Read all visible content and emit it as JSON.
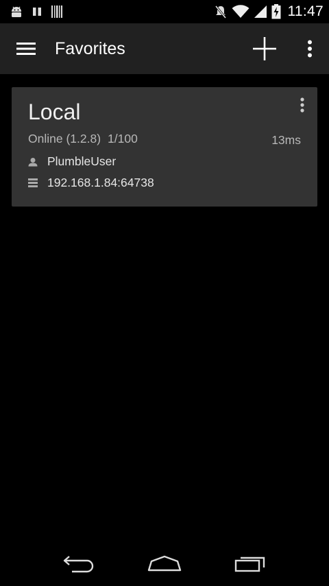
{
  "status_bar": {
    "time": "11:47",
    "left_icons": [
      "android-debug-icon",
      "pause-icon",
      "barcode-icon"
    ],
    "right_icons": [
      "mute-icon",
      "wifi-icon",
      "signal-icon",
      "battery-charging-icon"
    ]
  },
  "action_bar": {
    "title": "Favorites",
    "menu_icon": "hamburger-menu-icon",
    "add_icon": "plus-icon",
    "overflow_icon": "overflow-menu-icon"
  },
  "servers": [
    {
      "name": "Local",
      "status": "Online (1.2.8)",
      "users": "1/100",
      "latency": "13ms",
      "username": "PlumbleUser",
      "address": "192.168.1.84:64738"
    }
  ],
  "nav_bar": {
    "back_icon": "back-icon",
    "home_icon": "home-icon",
    "recents_icon": "recents-icon"
  },
  "colors": {
    "background": "#000000",
    "action_bar": "#212121",
    "card": "#333333",
    "text_primary": "#ffffff",
    "text_secondary": "#b8b8b8"
  }
}
